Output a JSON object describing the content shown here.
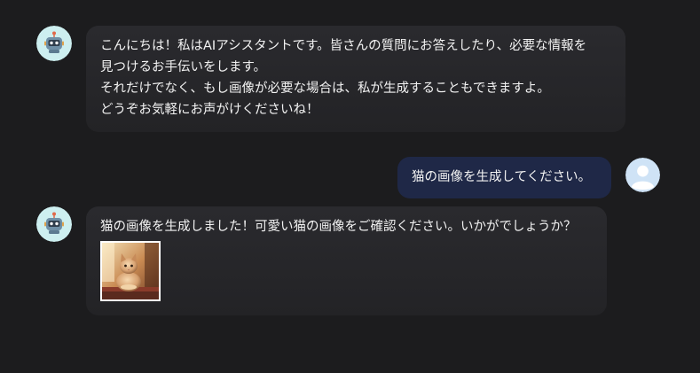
{
  "messages": {
    "assistant_greeting": {
      "lines": [
        "こんにちは！私はAIアシスタントです。皆さんの質問にお答えしたり、必要な情報を",
        "見つけるお手伝いをします。",
        "それだけでなく、もし画像が必要な場合は、私が生成することもできますよ。",
        "どうぞお気軽にお声がけくださいね！"
      ]
    },
    "user_request": {
      "text": "猫の画像を生成してください。"
    },
    "assistant_reply": {
      "text": "猫の画像を生成しました！可愛い猫の画像をご確認ください。いかがでしょうか？",
      "image": "cat-photo"
    }
  },
  "avatars": {
    "assistant": "robot-icon",
    "user": "user-icon"
  },
  "colors": {
    "background": "#1c1c1e",
    "assistant_bubble": "#2a2a2e",
    "user_bubble": "#1f2847",
    "assistant_avatar_bg": "#cdeff0",
    "user_avatar_bg": "#cfe3f6"
  }
}
